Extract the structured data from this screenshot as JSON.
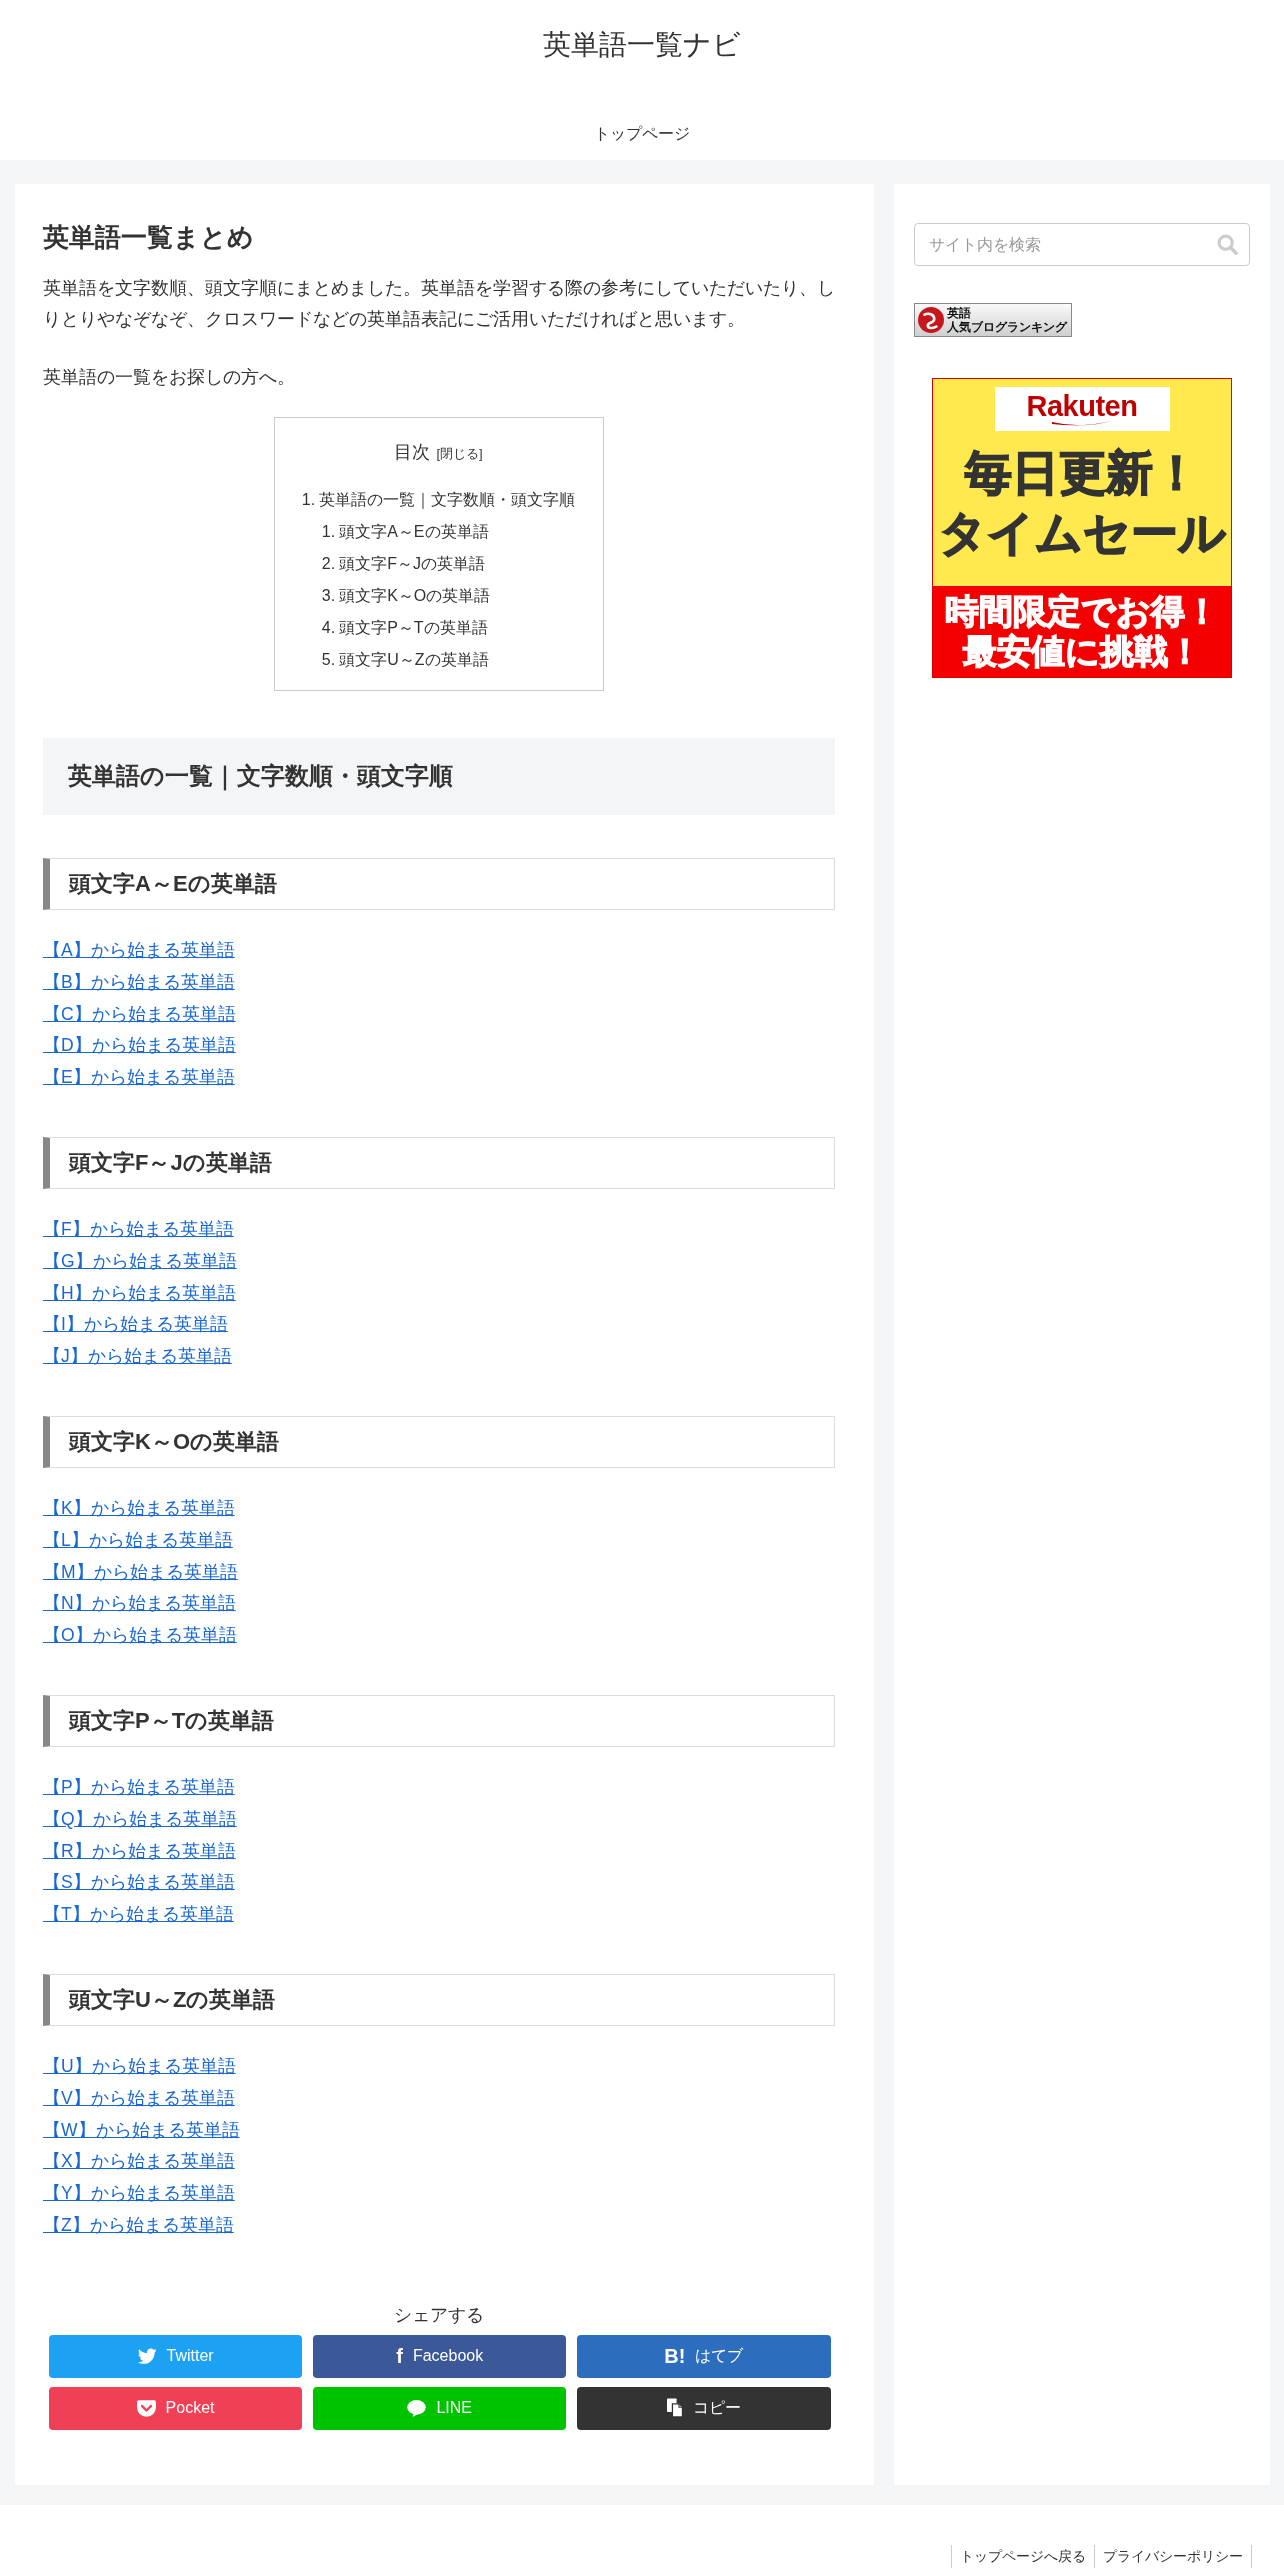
{
  "header": {
    "site_title": "英単語一覧ナビ",
    "nav": [
      {
        "label": "トップページ"
      }
    ]
  },
  "article": {
    "title": "英単語一覧まとめ",
    "paragraphs": [
      "英単語を文字数順、頭文字順にまとめました。英単語を学習する際の参考にしていただいたり、しりとりやなぞなぞ、クロスワードなどの英単語表記にご活用いただければと思います。",
      "英単語の一覧をお探しの方へ。"
    ],
    "toc": {
      "title": "目次",
      "toggle": "[閉じる]",
      "items": [
        {
          "number": "1.",
          "label": "英単語の一覧｜文字数順・頭文字順",
          "children": [
            {
              "number": "1.",
              "label": "頭文字A～Eの英単語"
            },
            {
              "number": "2.",
              "label": "頭文字F～Jの英単語"
            },
            {
              "number": "3.",
              "label": "頭文字K～Oの英単語"
            },
            {
              "number": "4.",
              "label": "頭文字P～Tの英単語"
            },
            {
              "number": "5.",
              "label": "頭文字U～Zの英単語"
            }
          ]
        }
      ]
    },
    "heading": "英単語の一覧｜文字数順・頭文字順",
    "sections": [
      {
        "heading": "頭文字A～Eの英単語",
        "links": [
          "【A】から始まる英単語",
          "【B】から始まる英単語",
          "【C】から始まる英単語",
          "【D】から始まる英単語",
          "【E】から始まる英単語"
        ]
      },
      {
        "heading": "頭文字F～Jの英単語",
        "links": [
          "【F】から始まる英単語",
          "【G】から始まる英単語",
          "【H】から始まる英単語",
          "【I】から始まる英単語",
          "【J】から始まる英単語"
        ]
      },
      {
        "heading": "頭文字K～Oの英単語",
        "links": [
          "【K】から始まる英単語",
          "【L】から始まる英単語",
          "【M】から始まる英単語",
          "【N】から始まる英単語",
          "【O】から始まる英単語"
        ]
      },
      {
        "heading": "頭文字P～Tの英単語",
        "links": [
          "【P】から始まる英単語",
          "【Q】から始まる英単語",
          "【R】から始まる英単語",
          "【S】から始まる英単語",
          "【T】から始まる英単語"
        ]
      },
      {
        "heading": "頭文字U～Zの英単語",
        "links": [
          "【U】から始まる英単語",
          "【V】から始まる英単語",
          "【W】から始まる英単語",
          "【X】から始まる英単語",
          "【Y】から始まる英単語",
          "【Z】から始まる英単語"
        ]
      }
    ]
  },
  "share": {
    "title": "シェアする",
    "buttons": [
      {
        "kind": "twitter",
        "label": "Twitter"
      },
      {
        "kind": "facebook",
        "icon": "f",
        "label": "Facebook"
      },
      {
        "kind": "hatebu",
        "icon": "B!",
        "label": "はてブ"
      },
      {
        "kind": "pocket",
        "label": "Pocket"
      },
      {
        "kind": "line",
        "label": "LINE"
      },
      {
        "kind": "copy",
        "label": "コピー"
      }
    ]
  },
  "sidebar": {
    "search": {
      "placeholder": "サイト内を検索"
    },
    "ranking_banner": {
      "title": "英語",
      "subtitle": "人気ブログランキング"
    },
    "ad": {
      "logo": "Rakuten",
      "headline": [
        "毎日更新！",
        "タイムセール"
      ],
      "band": [
        "時間限定でお得！",
        "最安値に挑戦！"
      ]
    }
  },
  "footer": {
    "links": [
      "トップページへ戻る",
      "プライバシーポリシー"
    ]
  }
}
